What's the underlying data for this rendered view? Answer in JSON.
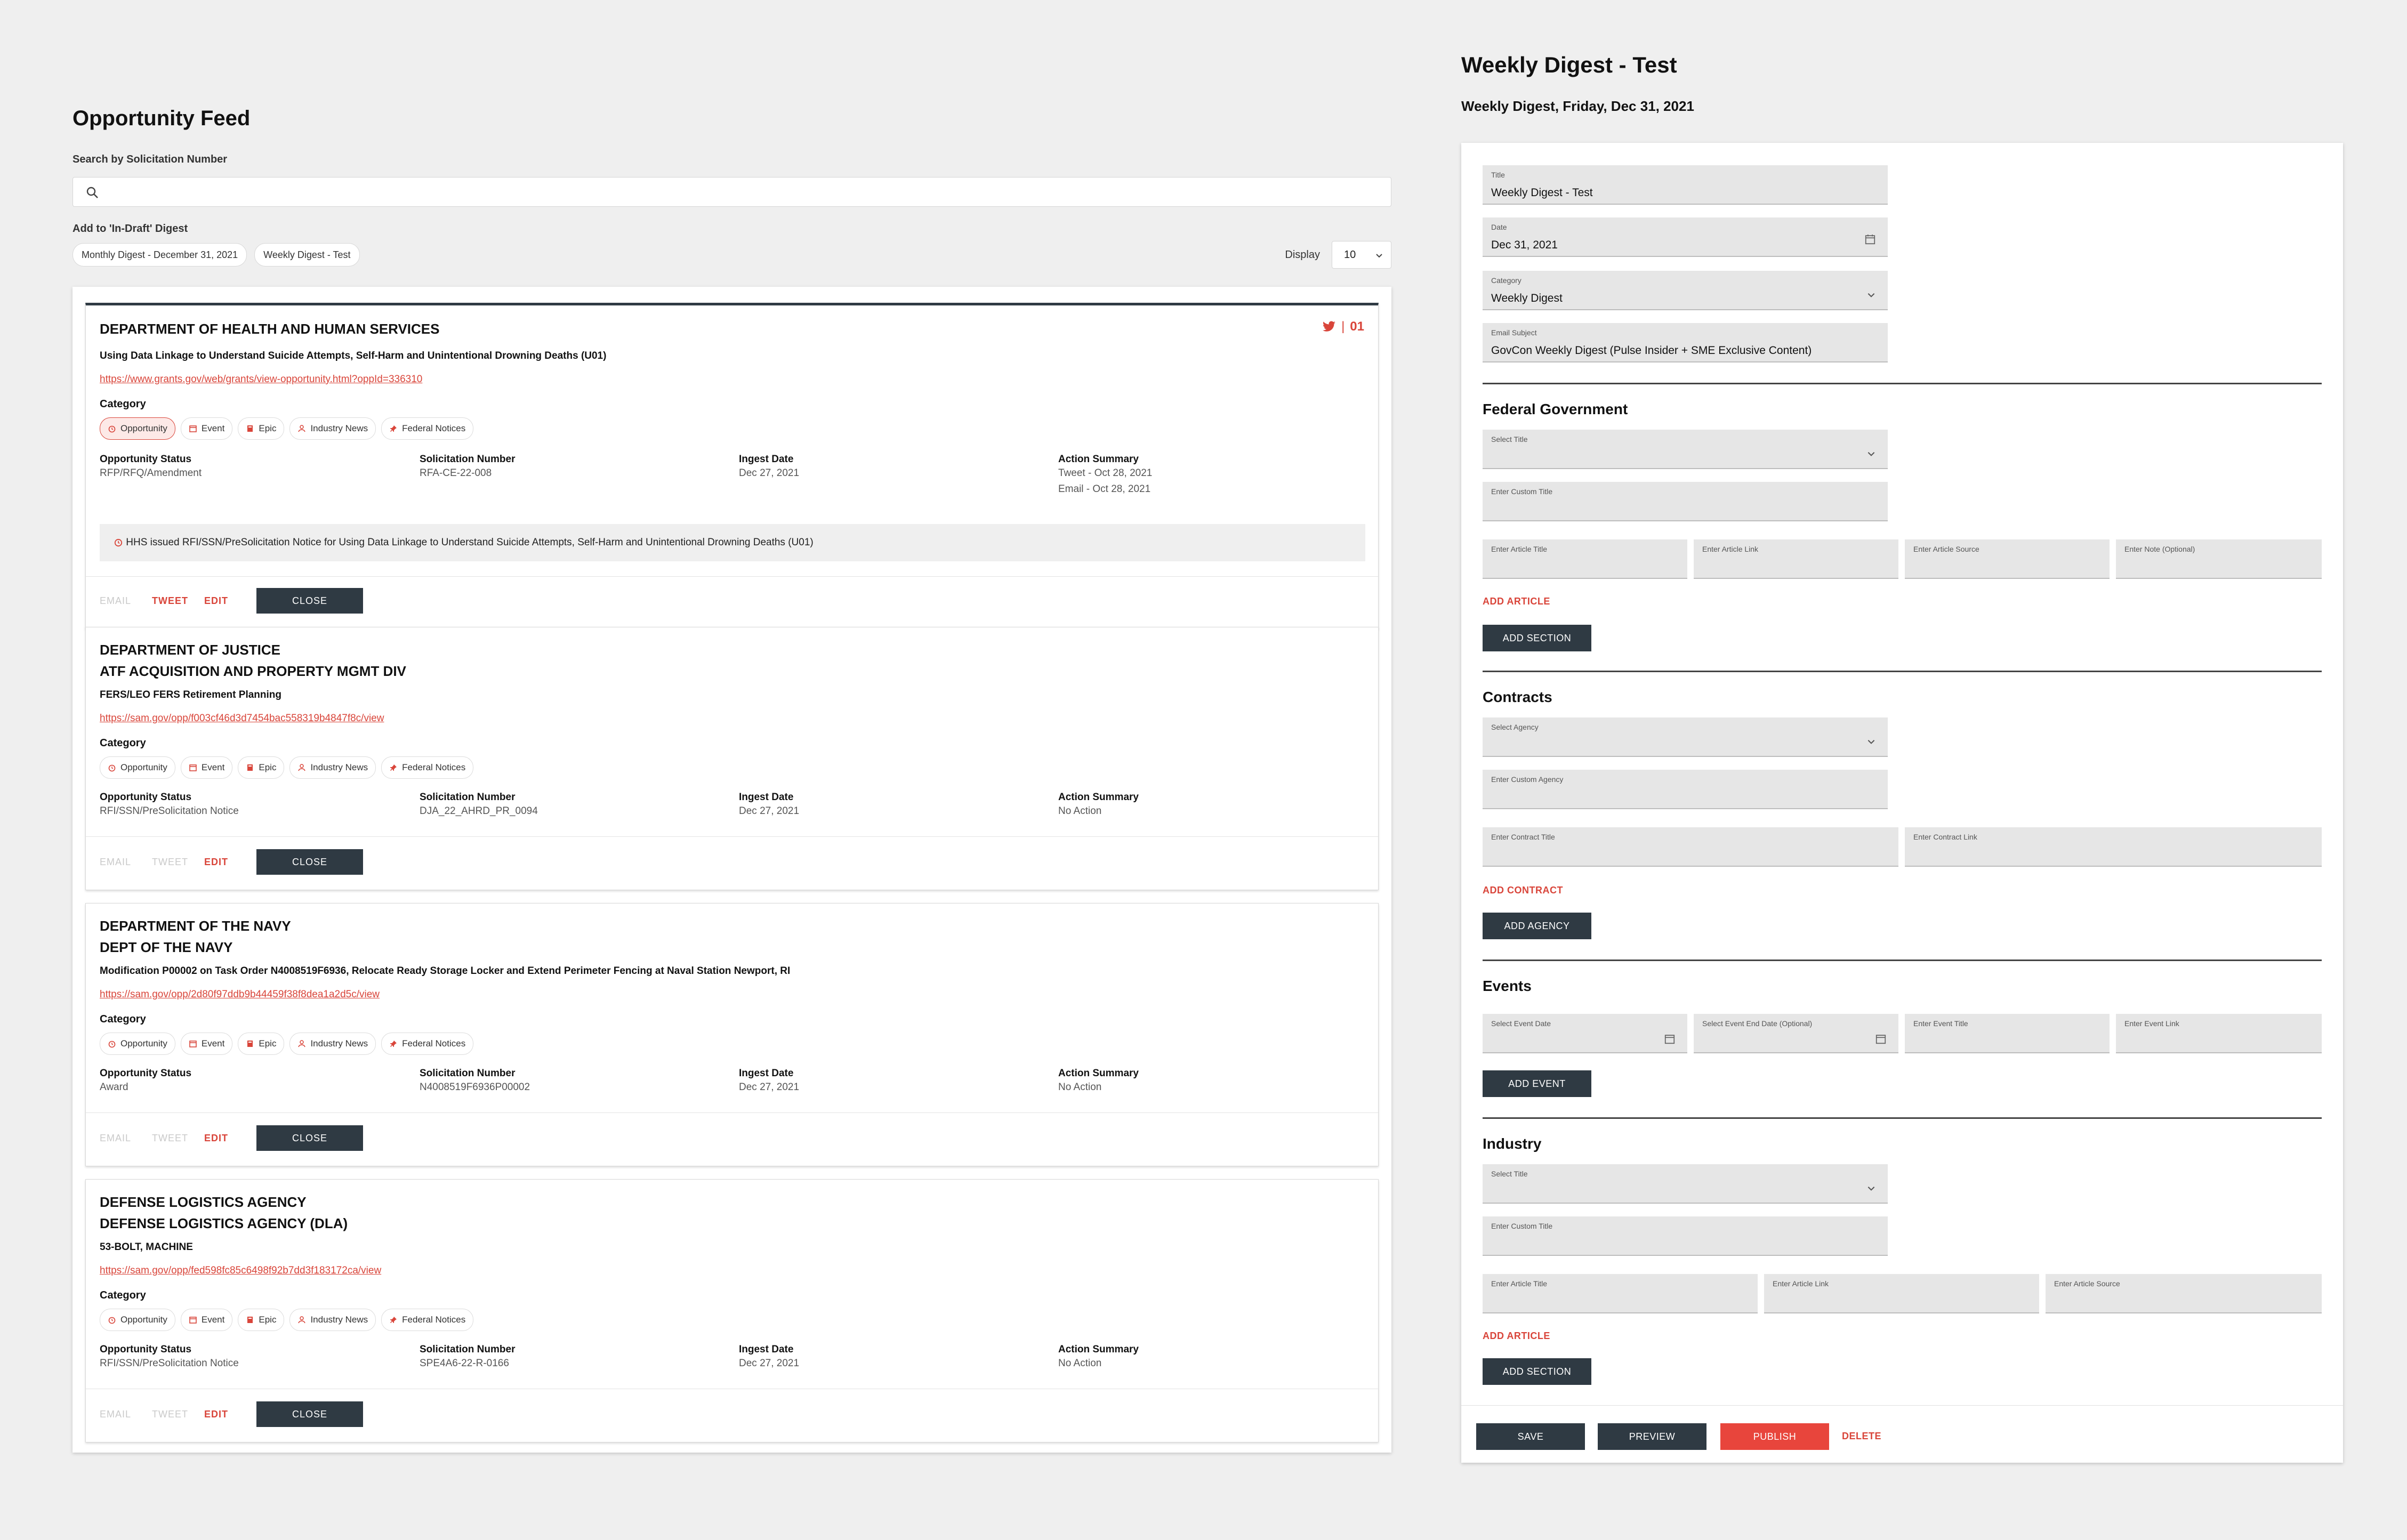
{
  "feed": {
    "title": "Opportunity Feed",
    "search_label": "Search by Solicitation Number",
    "search_placeholder": "",
    "add_label": "Add to 'In-Draft' Digest",
    "digest_chips": [
      "Monthly Digest - December 31, 2021",
      "Weekly Digest - Test"
    ],
    "display_label": "Display",
    "display_value": "10",
    "category_label": "Category",
    "categories": [
      "Opportunity",
      "Event",
      "Epic",
      "Industry News",
      "Federal Notices"
    ],
    "meta_headers": [
      "Opportunity Status",
      "Solicitation Number",
      "Ingest Date",
      "Action Summary"
    ],
    "actions": {
      "email": "EMAIL",
      "tweet": "TWEET",
      "edit": "EDIT",
      "close": "CLOSE"
    },
    "cards": [
      {
        "agency": "DEPARTMENT OF HEALTH AND HUMAN SERVICES",
        "title": "Using Data Linkage to Understand Suicide Attempts, Self-Harm and Unintentional Drowning Deaths (U01)",
        "link": "https://www.grants.gov/web/grants/view-opportunity.html?oppId=336310",
        "status": "RFP/RFQ/Amendment",
        "solicitation": "RFA-CE-22-008",
        "ingest": "Dec 27, 2021",
        "summary": [
          "Tweet - Oct 28, 2021",
          "Email - Oct 28, 2021"
        ],
        "notice": "HHS issued RFI/SSN/PreSolicitation Notice for Using Data Linkage to Understand Suicide Attempts, Self-Harm and Unintentional Drowning Deaths (U01)",
        "tweet_count": "01"
      },
      {
        "agency": "DEPARTMENT OF JUSTICE",
        "sub_agency": "ATF ACQUISITION AND PROPERTY MGMT DIV",
        "title": "FERS/LEO FERS Retirement Planning",
        "link": "https://sam.gov/opp/f003cf46d3d7454bac558319b4847f8c/view",
        "status": "RFI/SSN/PreSolicitation Notice",
        "solicitation": "DJA_22_AHRD_PR_0094",
        "ingest": "Dec 27, 2021",
        "summary": [
          "No Action"
        ]
      },
      {
        "agency": "DEPARTMENT OF THE NAVY",
        "sub_agency": "DEPT OF THE NAVY",
        "title": "Modification P00002 on Task Order N4008519F6936, Relocate Ready Storage Locker and Extend Perimeter Fencing at Naval Station Newport, RI",
        "link": "https://sam.gov/opp/2d80f97ddb9b44459f38f8dea1a2d5c/view",
        "status": "Award",
        "solicitation": "N4008519F6936P00002",
        "ingest": "Dec 27, 2021",
        "summary": [
          "No Action"
        ]
      },
      {
        "agency": "DEFENSE LOGISTICS AGENCY",
        "sub_agency": "DEFENSE LOGISTICS AGENCY (DLA)",
        "title": "53-BOLT, MACHINE",
        "link": "https://sam.gov/opp/fed598fc85c6498f92b7dd3f183172ca/view",
        "status": "RFI/SSN/PreSolicitation Notice",
        "solicitation": "SPE4A6-22-R-0166",
        "ingest": "Dec 27, 2021",
        "summary": [
          "No Action"
        ]
      }
    ]
  },
  "digest": {
    "title": "Weekly Digest - Test",
    "subtitle": "Weekly Digest, Friday, Dec 31, 2021",
    "fields": {
      "title": {
        "label": "Title",
        "value": "Weekly Digest - Test"
      },
      "date": {
        "label": "Date",
        "value": "Dec 31, 2021"
      },
      "category": {
        "label": "Category",
        "value": "Weekly Digest"
      },
      "email_subject": {
        "label": "Email Subject",
        "value": "GovCon Weekly Digest (Pulse Insider + SME Exclusive Content)"
      }
    },
    "federal": {
      "title": "Federal Government",
      "select_title": "Select Title",
      "custom_title": "Enter Custom Title",
      "article_title": "Enter Article Title",
      "article_link": "Enter Article Link",
      "article_source": "Enter Article Source",
      "note": "Enter Note (Optional)",
      "add_article": "ADD ARTICLE",
      "add_section": "ADD SECTION"
    },
    "contracts": {
      "title": "Contracts",
      "select_agency": "Select Agency",
      "custom_agency": "Enter Custom Agency",
      "contract_title": "Enter Contract Title",
      "contract_link": "Enter Contract Link",
      "add_contract": "ADD CONTRACT",
      "add_agency": "ADD AGENCY"
    },
    "events": {
      "title": "Events",
      "start_date": "Select Event Date",
      "end_date": "Select Event End Date (Optional)",
      "event_title": "Enter Event Title",
      "event_link": "Enter Event Link",
      "add_event": "ADD EVENT"
    },
    "industry": {
      "title": "Industry",
      "select_title": "Select Title",
      "custom_title": "Enter Custom Title",
      "article_title": "Enter Article Title",
      "article_link": "Enter Article Link",
      "article_source": "Enter Article Source",
      "add_article": "ADD ARTICLE",
      "add_section": "ADD SECTION"
    },
    "footer": {
      "save": "SAVE",
      "preview": "PREVIEW",
      "publish": "PUBLISH",
      "delete": "DELETE"
    }
  },
  "colors": {
    "accent": "#d9453a",
    "dark_button": "#2f3a43",
    "background": "#efefef",
    "field_bg": "#e6e6e6"
  },
  "icons": [
    "search-icon",
    "chevron-down-icon",
    "calendar-icon",
    "alarm-icon",
    "calendar-event-icon",
    "book-icon",
    "user-icon",
    "pin-icon",
    "twitter-icon"
  ]
}
